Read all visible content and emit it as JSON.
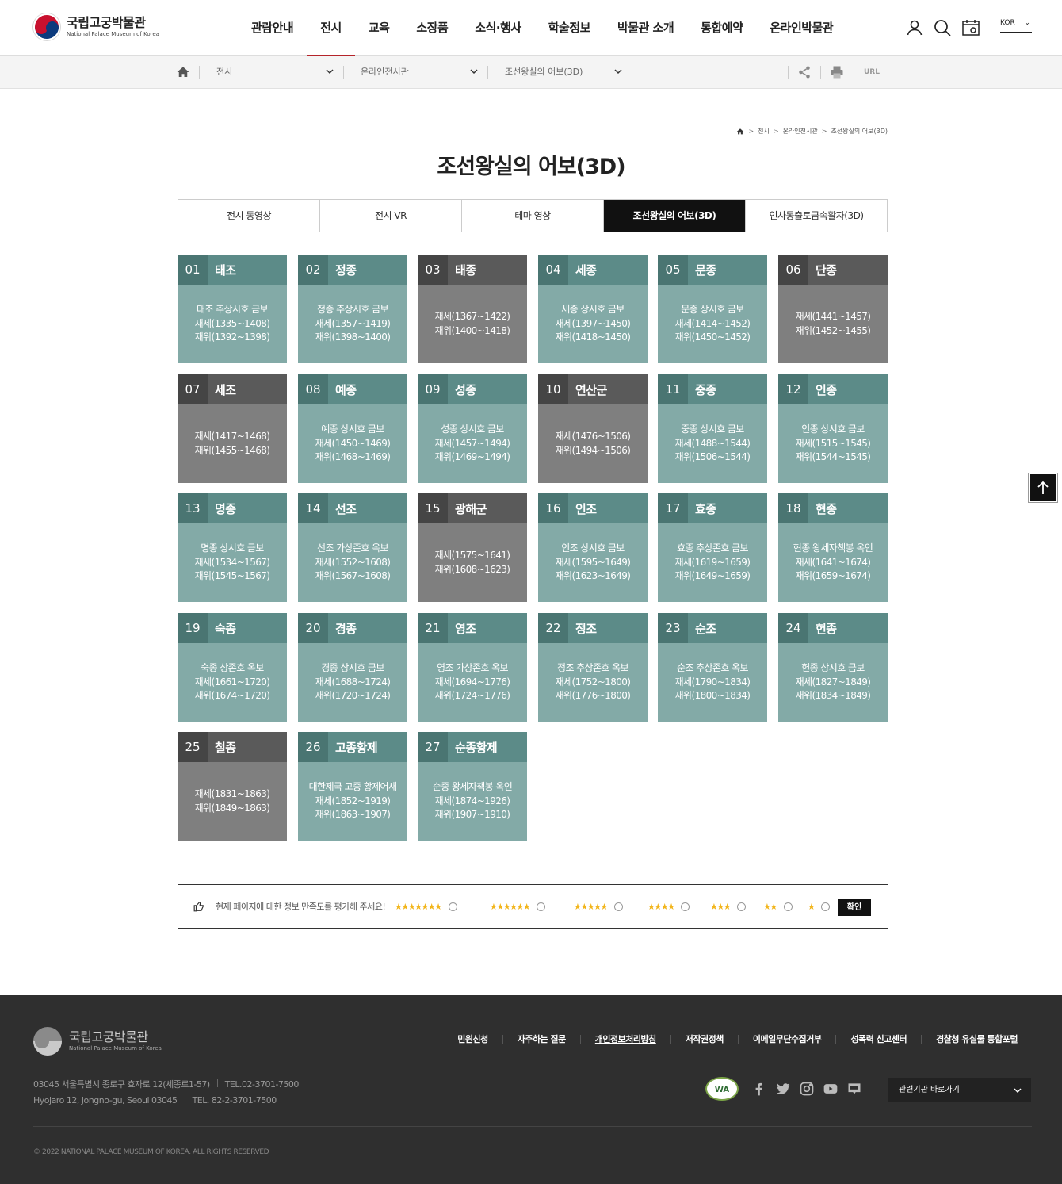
{
  "header": {
    "logo_ko": "국립고궁박물관",
    "logo_en": "National Palace Museum of Korea",
    "nav": [
      "관람안내",
      "전시",
      "교육",
      "소장품",
      "소식·행사",
      "학술정보",
      "박물관 소개",
      "통합예약",
      "온라인박물관"
    ],
    "active_nav": "전시",
    "lang": "KOR",
    "icons": [
      "user-icon",
      "search-icon",
      "calendar-icon"
    ]
  },
  "locbar": {
    "depth1": "전시",
    "depth2": "온라인전시관",
    "depth3": "조선왕실의 어보(3D)",
    "url_label": "URL",
    "icons": [
      "home-icon",
      "share-icon",
      "print-icon"
    ]
  },
  "breadcrumb": [
    "전시",
    "온라인전시관",
    "조선왕실의 어보(3D)"
  ],
  "page_title": "조선왕실의 어보(3D)",
  "tabs": [
    "전시 동영상",
    "전시 VR",
    "테마 영상",
    "조선왕실의 어보(3D)",
    "인사동출토금속활자(3D)"
  ],
  "active_tab": "조선왕실의 어보(3D)",
  "kings": [
    {
      "num": "01",
      "name": "태조",
      "style": "teal",
      "lines": [
        "태조 추상시호 금보",
        "재세(1335~1408)",
        "재위(1392~1398)"
      ]
    },
    {
      "num": "02",
      "name": "정종",
      "style": "teal",
      "lines": [
        "정종 추상시호 금보",
        "재세(1357~1419)",
        "재위(1398~1400)"
      ]
    },
    {
      "num": "03",
      "name": "태종",
      "style": "gray",
      "lines": [
        "재세(1367~1422)",
        "재위(1400~1418)"
      ]
    },
    {
      "num": "04",
      "name": "세종",
      "style": "teal",
      "lines": [
        "세종 상시호 금보",
        "재세(1397~1450)",
        "재위(1418~1450)"
      ]
    },
    {
      "num": "05",
      "name": "문종",
      "style": "teal",
      "lines": [
        "문종 상시호 금보",
        "재세(1414~1452)",
        "재위(1450~1452)"
      ]
    },
    {
      "num": "06",
      "name": "단종",
      "style": "gray",
      "lines": [
        "재세(1441~1457)",
        "재위(1452~1455)"
      ]
    },
    {
      "num": "07",
      "name": "세조",
      "style": "gray",
      "lines": [
        "재세(1417~1468)",
        "재위(1455~1468)"
      ]
    },
    {
      "num": "08",
      "name": "예종",
      "style": "teal",
      "lines": [
        "예종 상시호 금보",
        "재세(1450~1469)",
        "재위(1468~1469)"
      ]
    },
    {
      "num": "09",
      "name": "성종",
      "style": "teal",
      "lines": [
        "성종 상시호 금보",
        "재세(1457~1494)",
        "재위(1469~1494)"
      ]
    },
    {
      "num": "10",
      "name": "연산군",
      "style": "gray",
      "lines": [
        "재세(1476~1506)",
        "재위(1494~1506)"
      ]
    },
    {
      "num": "11",
      "name": "중종",
      "style": "teal",
      "lines": [
        "중종 상시호 금보",
        "재세(1488~1544)",
        "재위(1506~1544)"
      ]
    },
    {
      "num": "12",
      "name": "인종",
      "style": "teal",
      "lines": [
        "인종 상시호 금보",
        "재세(1515~1545)",
        "재위(1544~1545)"
      ]
    },
    {
      "num": "13",
      "name": "명종",
      "style": "teal",
      "lines": [
        "명종 상시호 금보",
        "재세(1534~1567)",
        "재위(1545~1567)"
      ]
    },
    {
      "num": "14",
      "name": "선조",
      "style": "teal",
      "lines": [
        "선조 가상존호 옥보",
        "재세(1552~1608)",
        "재위(1567~1608)"
      ]
    },
    {
      "num": "15",
      "name": "광해군",
      "style": "gray",
      "lines": [
        "재세(1575~1641)",
        "재위(1608~1623)"
      ]
    },
    {
      "num": "16",
      "name": "인조",
      "style": "teal",
      "lines": [
        "인조 상시호 금보",
        "재세(1595~1649)",
        "재위(1623~1649)"
      ]
    },
    {
      "num": "17",
      "name": "효종",
      "style": "teal",
      "lines": [
        "효종 추상존호 금보",
        "재세(1619~1659)",
        "재위(1649~1659)"
      ]
    },
    {
      "num": "18",
      "name": "현종",
      "style": "teal",
      "lines": [
        "현종 왕세자책봉 옥인",
        "재세(1641~1674)",
        "재위(1659~1674)"
      ]
    },
    {
      "num": "19",
      "name": "숙종",
      "style": "teal",
      "lines": [
        "숙종 상존호 옥보",
        "재세(1661~1720)",
        "재위(1674~1720)"
      ]
    },
    {
      "num": "20",
      "name": "경종",
      "style": "teal",
      "lines": [
        "경종 상시호 금보",
        "재세(1688~1724)",
        "재위(1720~1724)"
      ]
    },
    {
      "num": "21",
      "name": "영조",
      "style": "teal",
      "lines": [
        "영조 가상존호 옥보",
        "재세(1694~1776)",
        "재위(1724~1776)"
      ]
    },
    {
      "num": "22",
      "name": "정조",
      "style": "teal",
      "lines": [
        "정조 추상존호 옥보",
        "재세(1752~1800)",
        "재위(1776~1800)"
      ]
    },
    {
      "num": "23",
      "name": "순조",
      "style": "teal",
      "lines": [
        "순조 추상존호 옥보",
        "재세(1790~1834)",
        "재위(1800~1834)"
      ]
    },
    {
      "num": "24",
      "name": "헌종",
      "style": "teal",
      "lines": [
        "헌종 상시호 금보",
        "재세(1827~1849)",
        "재위(1834~1849)"
      ]
    },
    {
      "num": "25",
      "name": "철종",
      "style": "gray",
      "lines": [
        "재세(1831~1863)",
        "재위(1849~1863)"
      ]
    },
    {
      "num": "26",
      "name": "고종황제",
      "style": "teal",
      "lines": [
        "대한제국 고종 황제어새",
        "재세(1852~1919)",
        "재위(1863~1907)"
      ]
    },
    {
      "num": "27",
      "name": "순종황제",
      "style": "teal",
      "lines": [
        "순종 왕세자책봉 옥인",
        "재세(1874~1926)",
        "재위(1907~1910)"
      ]
    }
  ],
  "colors": {
    "teal_head": "#5c8b88",
    "teal_num": "#4a7572",
    "teal_body": "#83aaa7",
    "gray_head": "#5a5a5a",
    "gray_num": "#454545",
    "gray_body": "#7f7f7f",
    "accent": "#b5242a",
    "star": "#f2b51b"
  },
  "survey": {
    "question": "현재 페이지에 대한 정보 만족도를 평가해 주세요!",
    "ratings": [
      7,
      6,
      5,
      4,
      3,
      2,
      1
    ],
    "submit": "확인"
  },
  "footer": {
    "logo_ko": "국립고궁박물관",
    "logo_en": "National Palace Museum of Korea",
    "links": [
      "민원신청",
      "자주하는 질문",
      "개인정보처리방침",
      "저작권정책",
      "이메일무단수집거부",
      "성폭력 신고센터",
      "경찰청 유실물 통합포털"
    ],
    "address_ko": "03045 서울특별시 종로구 효자로 12(세종로1-57)",
    "tel_ko": "TEL.02-3701-7500",
    "address_en": "Hyojaro 12, Jongno-gu, Seoul 03045",
    "tel_en": "TEL. 82-2-3701-7500",
    "wa_mark": "WA",
    "sns": [
      "facebook-icon",
      "twitter-icon",
      "instagram-icon",
      "youtube-icon",
      "blog-icon"
    ],
    "family_site": "관련기관 바로가기",
    "copyright": "© 2022 NATIONAL PALACE MUSEUM OF KOREA. ALL RIGHTS RESERVED"
  }
}
